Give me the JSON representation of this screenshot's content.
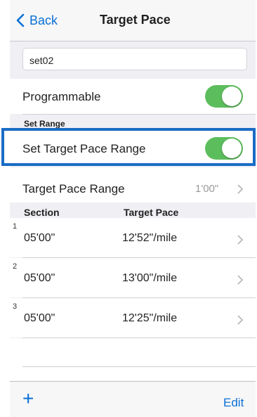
{
  "nav": {
    "back_label": "Back",
    "title": "Target Pace"
  },
  "name_field": {
    "value": "set02"
  },
  "programmable": {
    "label": "Programmable",
    "on": true
  },
  "set_range": {
    "header": "Set Range",
    "toggle_label": "Set Target Pace Range",
    "on": true
  },
  "pace_range": {
    "label": "Target Pace Range",
    "value": "1'00\""
  },
  "table": {
    "col_section": "Section",
    "col_pace": "Target Pace",
    "rows": [
      {
        "num": "1",
        "time": "05'00\"",
        "pace": "12'52\"/mile"
      },
      {
        "num": "2",
        "time": "05'00\"",
        "pace": "13'00\"/mile"
      },
      {
        "num": "3",
        "time": "05'00\"",
        "pace": "12'25\"/mile"
      }
    ]
  },
  "toolbar": {
    "add_label": "+",
    "edit_label": "Edit"
  },
  "colors": {
    "accent": "#0a6fd6",
    "toggle_on": "#5cbd5c",
    "highlight": "#1a6cc4"
  }
}
